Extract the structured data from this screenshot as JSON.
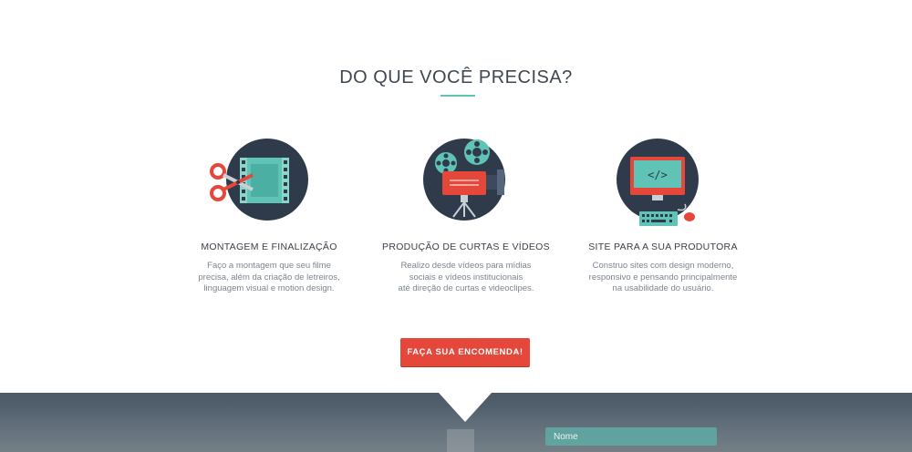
{
  "section": {
    "title": "DO QUE VOCÊ PRECISA?"
  },
  "services": [
    {
      "icon": "film-editing-icon",
      "title": "MONTAGEM E FINALIZAÇÃO",
      "description": "Faço a montagem que seu filme\nprecisa, além da criação de letreiros,\nlinguagem visual e motion design."
    },
    {
      "icon": "film-projector-icon",
      "title": "PRODUÇÃO DE CURTAS E VÍDEOS",
      "description": "Realizo desde vídeos para mídias\nsociais e vídeos institucionais\naté direção de curtas e videoclipes."
    },
    {
      "icon": "computer-code-icon",
      "title": "SITE PARA A SUA PRODUTORA",
      "description": "Construo sites com design moderno,\nresponsivo e pensando principalmente\nna usabilidade do usuário."
    }
  ],
  "cta": {
    "label": "FAÇA SUA ENCOMENDA!"
  },
  "form": {
    "name_placeholder": "Nome"
  },
  "colors": {
    "accent_teal": "#5fc3b6",
    "cta_red": "#e5473a",
    "icon_navy": "#2f3a4b",
    "heading": "#3f4852",
    "body_text": "#7d8590"
  }
}
